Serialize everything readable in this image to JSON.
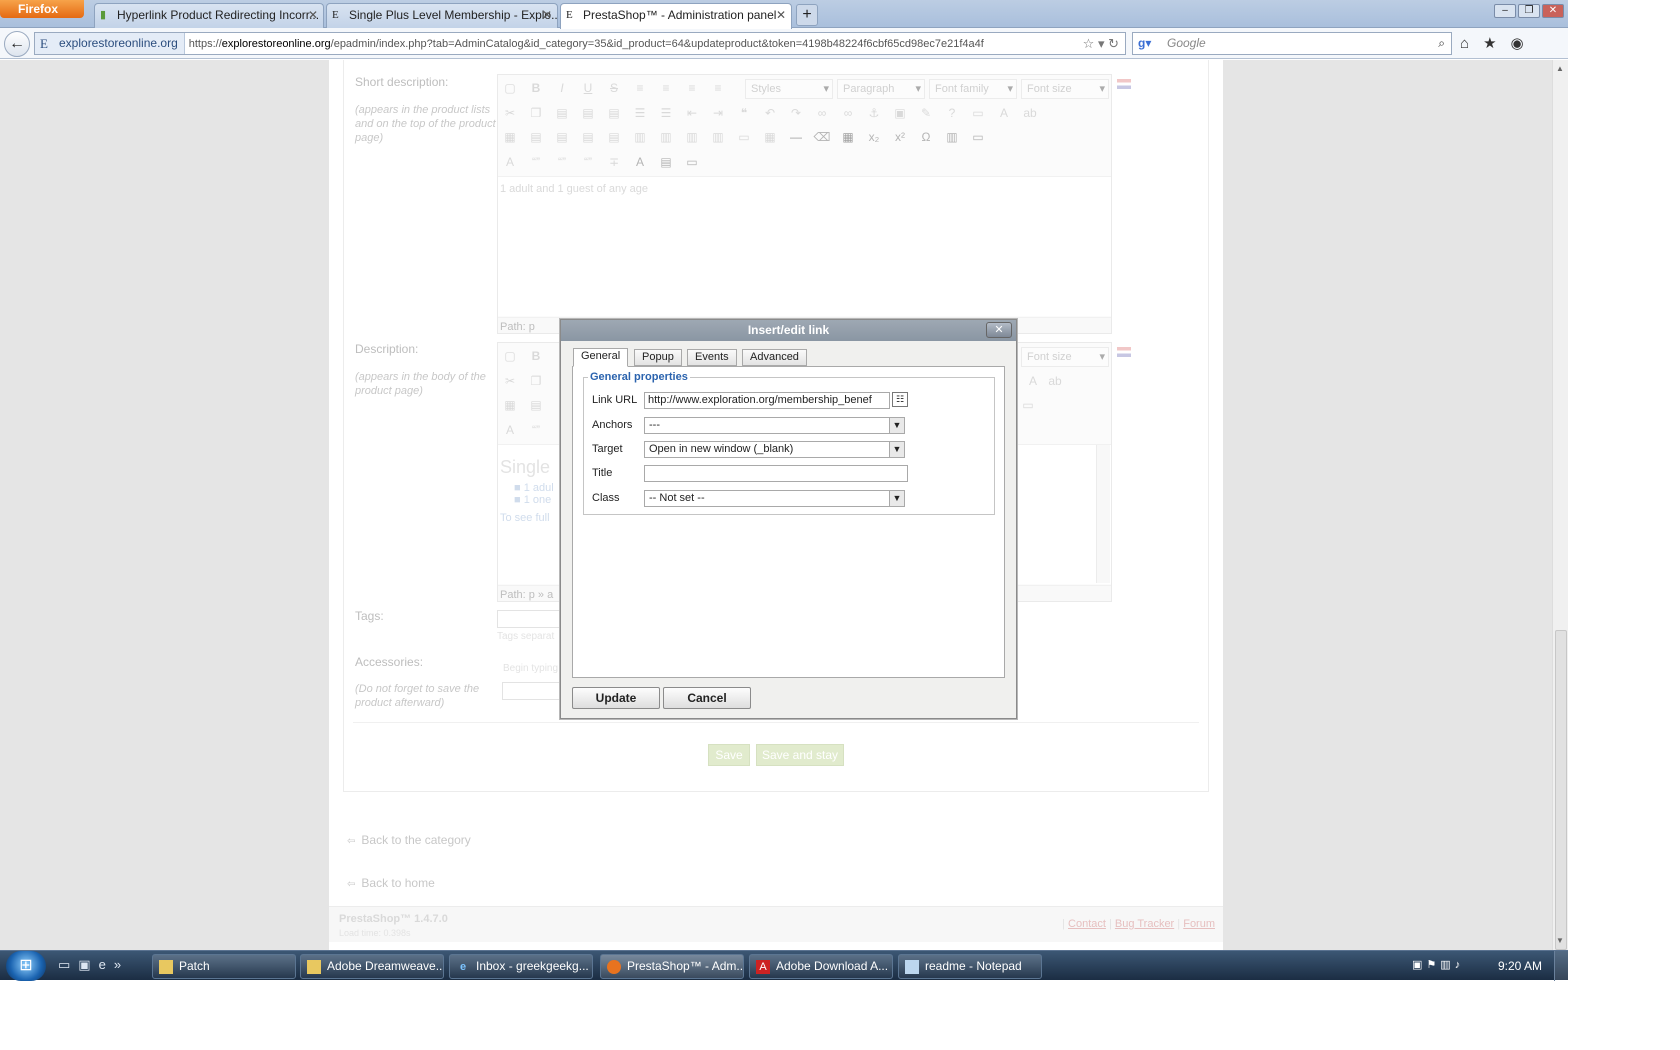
{
  "browser": {
    "app_button": "Firefox",
    "tabs": [
      {
        "label": "Hyperlink Product Redirecting Incorr...",
        "favicon": "bookmark-icon"
      },
      {
        "label": "Single Plus Level Membership - Explo...",
        "favicon": "explorestore-favicon"
      },
      {
        "label": "PrestaShop™ - Administration panel",
        "favicon": "explorestore-favicon"
      }
    ],
    "new_tab": "+",
    "site_identity": "explorestoreonline.org",
    "url_prefix": "https://",
    "url_domain": "explorestoreonline.org",
    "url_rest": "/epadmin/index.php?tab=AdminCatalog&id_category=35&id_product=64&updateproduct&token=4198b48224f6cbf65cd98ec7e21f4a4f",
    "search_placeholder": "Google"
  },
  "form": {
    "short_description_label": "Short description:",
    "short_description_hint": "(appears in the product lists and on the top of the product page)",
    "short_description_text": "1 adult and 1 guest of any age",
    "short_path": "Path: p",
    "description_label": "Description:",
    "description_hint": "(appears in the body of the product page)",
    "description_heading": "Single",
    "description_bullets": [
      "1 adul",
      "1 one"
    ],
    "description_more": "To see full",
    "description_path": "Path: p » a",
    "tags_label": "Tags:",
    "tags_hint": "Tags separat",
    "accessories_label": "Accessories:",
    "accessories_hint": "(Do not forget to save the product afterward)",
    "accessories_placeholder": "Begin typing",
    "save_label": "Save",
    "save_stay_label": "Save and stay",
    "toolbar": {
      "styles": "Styles",
      "paragraph": "Paragraph",
      "font_family": "Font family",
      "font_size": "Font size"
    }
  },
  "links": {
    "back_category": "Back to the category",
    "back_home": "Back to home"
  },
  "footer": {
    "version": "PrestaShop™ 1.4.7.0",
    "load_time": "Load time: 0.398s",
    "contact": "Contact",
    "bug_tracker": "Bug Tracker",
    "forum": "Forum"
  },
  "dialog": {
    "title": "Insert/edit link",
    "tabs": [
      "General",
      "Popup",
      "Events",
      "Advanced"
    ],
    "active_tab": "General",
    "legend": "General properties",
    "link_url_label": "Link URL",
    "link_url_value": "http://www.exploration.org/membership_benef",
    "anchors_label": "Anchors",
    "anchors_value": "---",
    "target_label": "Target",
    "target_value": "Open in new window (_blank)",
    "title_label": "Title",
    "title_value": "",
    "class_label": "Class",
    "class_value": "-- Not set --",
    "update_label": "Update",
    "cancel_label": "Cancel"
  },
  "taskbar": {
    "items": [
      {
        "label": "Patch",
        "icon": "folder-icon"
      },
      {
        "label": "Adobe Dreamweave...",
        "icon": "folder-icon"
      },
      {
        "label": "Inbox - greekgeekg...",
        "icon": "ie-icon"
      },
      {
        "label": "PrestaShop™ - Adm...",
        "icon": "firefox-icon"
      },
      {
        "label": "Adobe Download A...",
        "icon": "adobe-icon"
      },
      {
        "label": "readme - Notepad",
        "icon": "notepad-icon"
      }
    ],
    "clock": "9:20 AM"
  }
}
